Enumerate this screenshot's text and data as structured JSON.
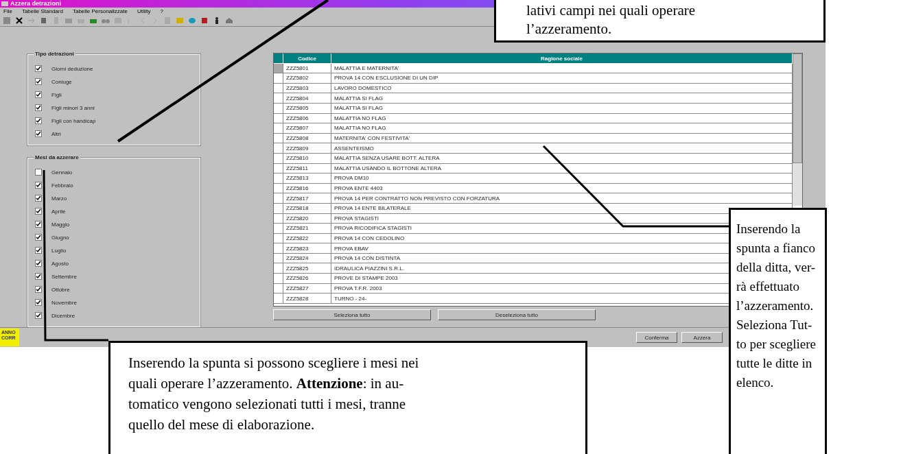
{
  "window": {
    "title": "Azzera detrazioni"
  },
  "menu": [
    {
      "label": "File"
    },
    {
      "label": "Tabelle Standard"
    },
    {
      "label": "Tabelle Personalizzate"
    },
    {
      "label": "Utility"
    },
    {
      "label": "?"
    }
  ],
  "deduction_types": {
    "title": "Tipo detrazioni",
    "items": [
      {
        "label": "Giorni deduzione",
        "checked": true
      },
      {
        "label": "Coniuge",
        "checked": true
      },
      {
        "label": "Figli",
        "checked": true
      },
      {
        "label": "Figli minori 3 anni",
        "checked": true
      },
      {
        "label": "Figli con handicap",
        "checked": true
      },
      {
        "label": "Altri",
        "checked": true
      }
    ]
  },
  "months": {
    "title": "Mesi da azzerare",
    "items": [
      {
        "label": "Gennaio",
        "checked": false
      },
      {
        "label": "Febbraio",
        "checked": true
      },
      {
        "label": "Marzo",
        "checked": true
      },
      {
        "label": "Aprile",
        "checked": true
      },
      {
        "label": "Maggio",
        "checked": true
      },
      {
        "label": "Giugno",
        "checked": true
      },
      {
        "label": "Luglio",
        "checked": true
      },
      {
        "label": "Agosto",
        "checked": true
      },
      {
        "label": "Settembre",
        "checked": true
      },
      {
        "label": "Ottobre",
        "checked": true
      },
      {
        "label": "Novembre",
        "checked": true
      },
      {
        "label": "Dicembre",
        "checked": true
      }
    ]
  },
  "table": {
    "columns": [
      "Codice",
      "Ragione sociale"
    ],
    "rows": [
      {
        "code": "ZZZ5801",
        "name": "MALATTIA E MATERNITA'",
        "selected": true
      },
      {
        "code": "ZZZ5802",
        "name": "PROVA 14 CON ESCLUSIONE DI UN DIP",
        "selected": false
      },
      {
        "code": "ZZZ5803",
        "name": "LAVORO DOMESTICO",
        "selected": false
      },
      {
        "code": "ZZZ5804",
        "name": "MALATTIA SI FLAG",
        "selected": false
      },
      {
        "code": "ZZZ5805",
        "name": "MALATTIA SI FLAG",
        "selected": false
      },
      {
        "code": "ZZZ5806",
        "name": "MALATTIA NO FLAG",
        "selected": false
      },
      {
        "code": "ZZZ5807",
        "name": "MALATTIA NO FLAG",
        "selected": false
      },
      {
        "code": "ZZZ5808",
        "name": "MATERNITA' CON FESTIVITA'",
        "selected": false
      },
      {
        "code": "ZZZ5809",
        "name": "ASSENTEISMO",
        "selected": false
      },
      {
        "code": "ZZZ5810",
        "name": "MALATTIA SENZA USARE BOTT. ALTERA",
        "selected": false
      },
      {
        "code": "ZZZ5811",
        "name": "MALATTIA USANDO IL BOTTONE ALTERA",
        "selected": false
      },
      {
        "code": "ZZZ5813",
        "name": "PROVA DM10",
        "selected": false
      },
      {
        "code": "ZZZ5816",
        "name": "PROVA ENTE 4403",
        "selected": false
      },
      {
        "code": "ZZZ5817",
        "name": "PROVA 14 PER CONTRATTO NON PREVISTO CON FORZATURA",
        "selected": false
      },
      {
        "code": "ZZZ5818",
        "name": "PROVA 14 ENTE BILATERALE",
        "selected": false
      },
      {
        "code": "ZZZ5820",
        "name": "PROVA STAGISTI",
        "selected": false
      },
      {
        "code": "ZZZ5821",
        "name": "PROVA RICODIFICA STAGISTI",
        "selected": false
      },
      {
        "code": "ZZZ5822",
        "name": "PROVA 14 CON CEDOLINO",
        "selected": false
      },
      {
        "code": "ZZZ5823",
        "name": "PROVA EBAV",
        "selected": false
      },
      {
        "code": "ZZZ5824",
        "name": "PROVA 14 CON DISTINTA",
        "selected": false
      },
      {
        "code": "ZZZ5825",
        "name": "IDRAULICA PIAZZINI S.R.L.",
        "selected": false
      },
      {
        "code": "ZZZ5826",
        "name": "PROVE DI STAMPE 2003",
        "selected": false
      },
      {
        "code": "ZZZ5827",
        "name": "PROVA T.F.R. 2003",
        "selected": false
      },
      {
        "code": "ZZZ5828",
        "name": "TURNO - 24-",
        "selected": false
      }
    ]
  },
  "table_buttons": [
    "Seleziona tutto",
    "Deseleziona tutto"
  ],
  "year_badge": "ANNO CORR",
  "bottom_buttons": [
    "Conferma",
    "Azzera"
  ],
  "callouts": [
    {
      "kind": "top",
      "text": "lativi campi nei quali operare\nl’azzeramento."
    },
    {
      "kind": "bottom",
      "text": "Inserendo la spunta si possono scegliere i mesi nei\nquali operare l’azzeramento. **Attenzione**: in au-\ntomatico vengono selezionati tutti i mesi, tranne\nquello del mese di elaborazione."
    },
    {
      "kind": "right",
      "text": "Inserendo la\nspunta a fianco\ndella ditta, ver-\nrà effettuato\nl’azzeramento.\nSeleziona Tut-\nto per scegliere\ntutte le ditte in\nelenco."
    }
  ]
}
